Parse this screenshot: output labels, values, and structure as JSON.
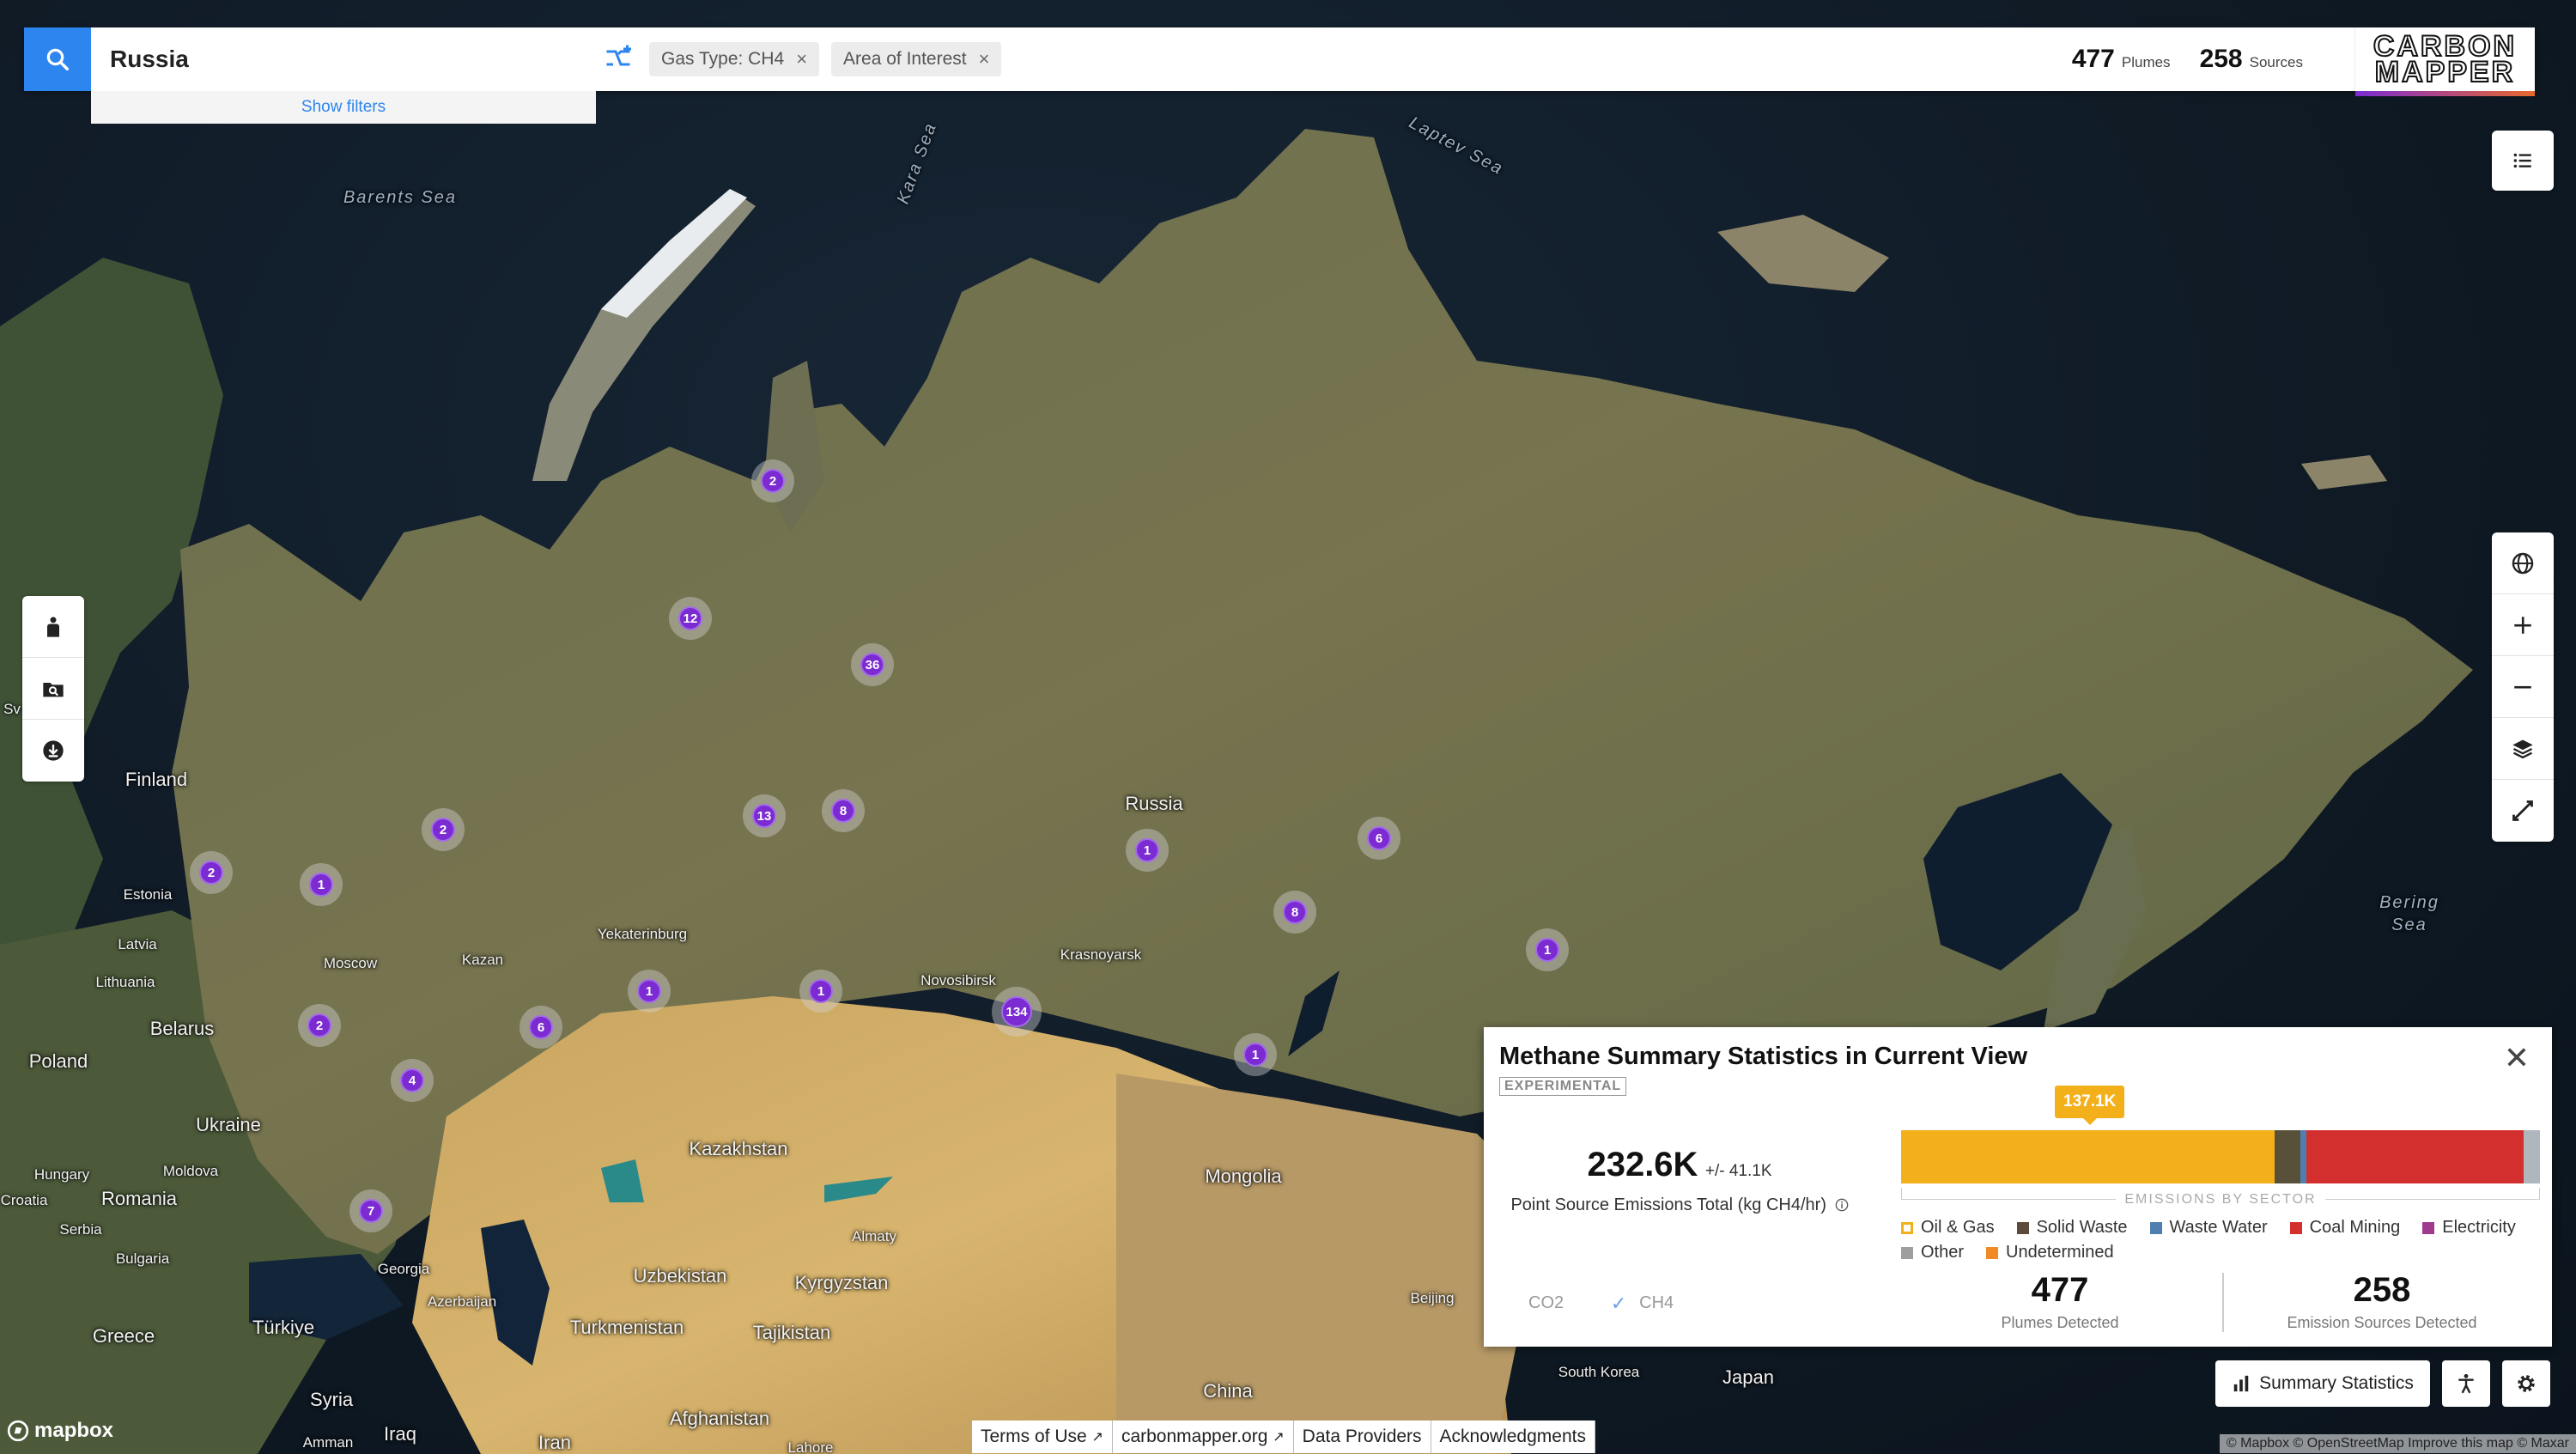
{
  "search": {
    "value": "Russia",
    "show_filters": "Show filters"
  },
  "chips": [
    {
      "label": "Gas Type: CH4",
      "close": "×"
    },
    {
      "label": "Area of Interest",
      "close": "×"
    }
  ],
  "counts": {
    "plumes_num": "477",
    "plumes_label": "Plumes",
    "sources_num": "258",
    "sources_label": "Sources"
  },
  "logo": {
    "line1": "CARBON",
    "line2": "MAPPER"
  },
  "map_labels": {
    "barents_sea": "Barents Sea",
    "kara_sea": "Kara Sea",
    "laptev_sea": "Laptev Sea",
    "bering_sea": "Bering Sea",
    "russia": "Russia",
    "finland": "Finland",
    "estonia": "Estonia",
    "latvia": "Latvia",
    "lithuania": "Lithuania",
    "poland": "Poland",
    "belarus": "Belarus",
    "ukraine": "Ukraine",
    "hungary": "Hungary",
    "moldova": "Moldova",
    "romania": "Romania",
    "croatia": "Croatia",
    "serbia": "Serbia",
    "bulgaria": "Bulgaria",
    "greece": "Greece",
    "turkiye": "Türkiye",
    "syria": "Syria",
    "iraq": "Iraq",
    "iran": "Iran",
    "amman": "Amman",
    "georgia": "Georgia",
    "azerbaijan": "Azerbaijan",
    "moscow": "Moscow",
    "kazan": "Kazan",
    "yekaterinburg": "Yekaterinburg",
    "novosibirsk": "Novosibirsk",
    "krasnoyarsk": "Krasnoyarsk",
    "kazakhstan": "Kazakhstan",
    "uzbekistan": "Uzbekistan",
    "turkmenistan": "Turkmenistan",
    "kyrgyzstan": "Kyrgyzstan",
    "tajikistan": "Tajikistan",
    "afghanistan": "Afghanistan",
    "almaty": "Almaty",
    "mongolia": "Mongolia",
    "china": "China",
    "beijing": "Beijing",
    "south_korea": "South Korea",
    "japan": "Japan",
    "sv": "Sv",
    "lahore": "Lahore"
  },
  "clusters": [
    "2",
    "12",
    "36",
    "13",
    "8",
    "2",
    "2",
    "1",
    "1",
    "6",
    "8",
    "1",
    "2",
    "6",
    "4",
    "1",
    "1",
    "134",
    "1",
    "7"
  ],
  "panel": {
    "title": "Methane Summary Statistics in Current View",
    "experimental": "EXPERIMENTAL",
    "close": "✕",
    "total_value": "232.6K",
    "total_error": "+/- 41.1K",
    "total_label": "Point Source Emissions Total (kg CH4/hr)",
    "tooltip": "137.1K",
    "axis_label": "EMISSIONS BY SECTOR",
    "gas_co2": "CO2",
    "gas_ch4": "CH4",
    "plumes_value": "477",
    "plumes_label": "Plumes Detected",
    "sources_value": "258",
    "sources_label": "Emission Sources Detected",
    "legend": [
      {
        "label": "Oil & Gas",
        "color": "#f4b01a",
        "hollow": true
      },
      {
        "label": "Solid Waste",
        "color": "#5c4a3a"
      },
      {
        "label": "Waste Water",
        "color": "#4f7fb0"
      },
      {
        "label": "Coal Mining",
        "color": "#d32f2f"
      },
      {
        "label": "Electricity",
        "color": "#a03a8c"
      },
      {
        "label": "Other",
        "color": "#9e9e9e"
      },
      {
        "label": "Undetermined",
        "color": "#f08a24"
      }
    ],
    "sectors": [
      {
        "name": "Oil & Gas",
        "share": 0.585,
        "color": "#f4b01a"
      },
      {
        "name": "Solid Waste",
        "share": 0.04,
        "color": "#585039"
      },
      {
        "name": "Waste Water",
        "share": 0.01,
        "color": "#4f7fb0"
      },
      {
        "name": "Coal Mining",
        "share": 0.34,
        "color": "#d32f2f"
      },
      {
        "name": "Other",
        "share": 0.025,
        "color": "#b0b6bd"
      }
    ]
  },
  "bottom": {
    "summary_button": "Summary Statistics",
    "links": [
      "Terms of Use",
      "carbonmapper.org",
      "Data Providers",
      "Acknowledgments"
    ],
    "mapbox": "mapbox",
    "attribution": "© Mapbox © OpenStreetMap  Improve this map © Maxar"
  }
}
